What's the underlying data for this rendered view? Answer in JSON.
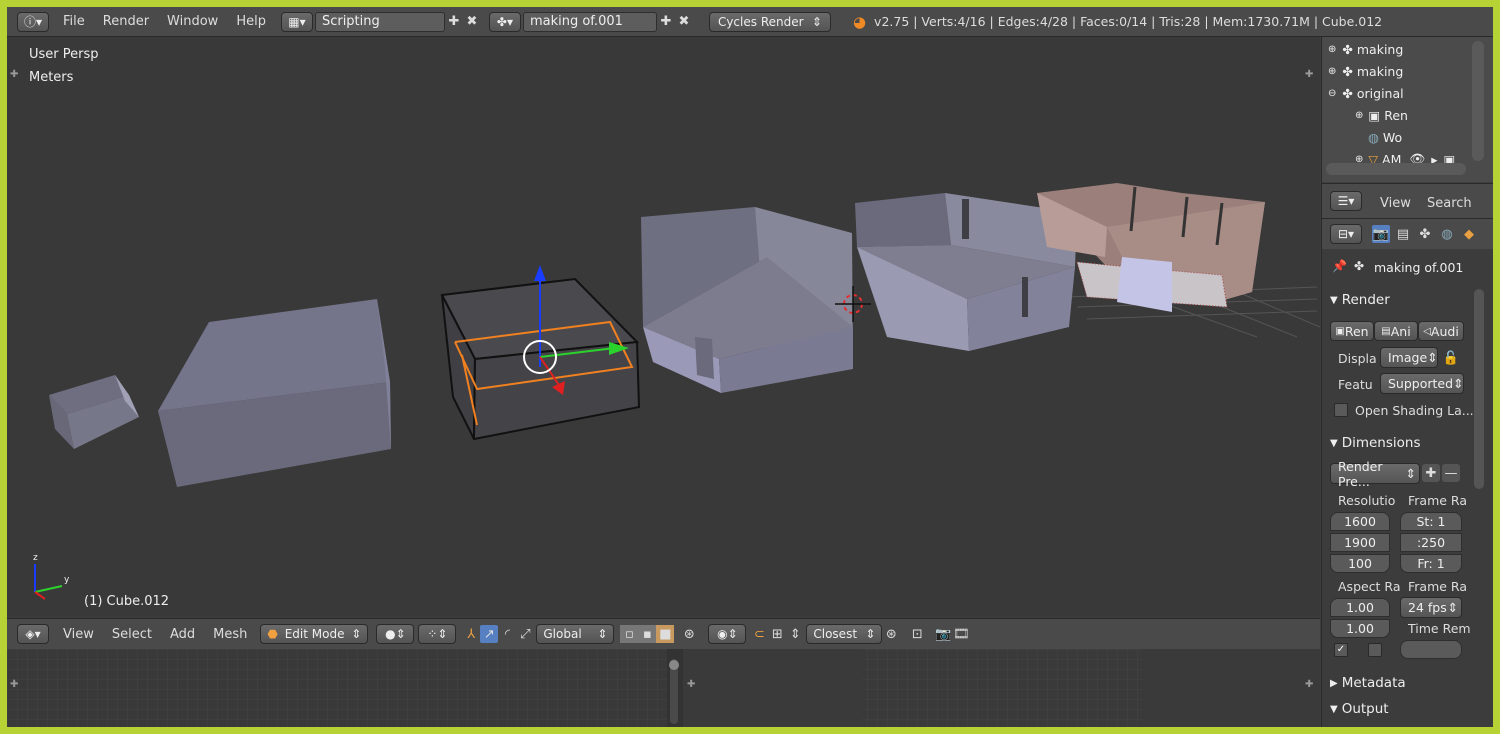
{
  "menu": {
    "file": "File",
    "render": "Render",
    "window": "Window",
    "help": "Help"
  },
  "screen_layout": "Scripting",
  "scene": "making of.001",
  "render_engine": "Cycles Render",
  "stats": "v2.75 | Verts:4/16 | Edges:4/28 | Faces:0/14 | Tris:28 | Mem:1730.71M | Cube.012",
  "viewport": {
    "view_name": "User Persp",
    "units": "Meters",
    "object_label": "(1) Cube.012",
    "axis_z": "z",
    "axis_y": "y"
  },
  "header3d": {
    "view": "View",
    "select": "Select",
    "add": "Add",
    "mesh": "Mesh",
    "mode": "Edit Mode",
    "orientation": "Global",
    "snap": "Closest"
  },
  "outliner": {
    "rows": [
      "making",
      "making",
      "original",
      "Ren",
      "Wo",
      "AM"
    ]
  },
  "properties": {
    "view": "View",
    "search": "Search",
    "scene_name": "making of.001",
    "render_panel": "Render",
    "render_btn": "Ren",
    "anim_btn": "Ani",
    "audio_btn": "Audi",
    "display_label": "Displa",
    "display_value": "Image",
    "feature_label": "Featu",
    "feature_value": "Supported",
    "open_shading": "Open Shading La...",
    "dimensions_panel": "Dimensions",
    "presets": "Render Pre...",
    "resolution": "Resolutio",
    "frame_range": "Frame Ra",
    "res_x": "1600",
    "res_y": "1900",
    "res_pct": "100",
    "start": "St:  1",
    "end": ":250",
    "frame_step": "Fr:  1",
    "aspect": "Aspect Ra",
    "frame_rate": "Frame Ra",
    "aspect_x": "1.00",
    "aspect_y": "1.00",
    "fps": "24 fps",
    "time_rem": "Time Rem",
    "metadata_panel": "Metadata",
    "output_panel": "Output"
  }
}
